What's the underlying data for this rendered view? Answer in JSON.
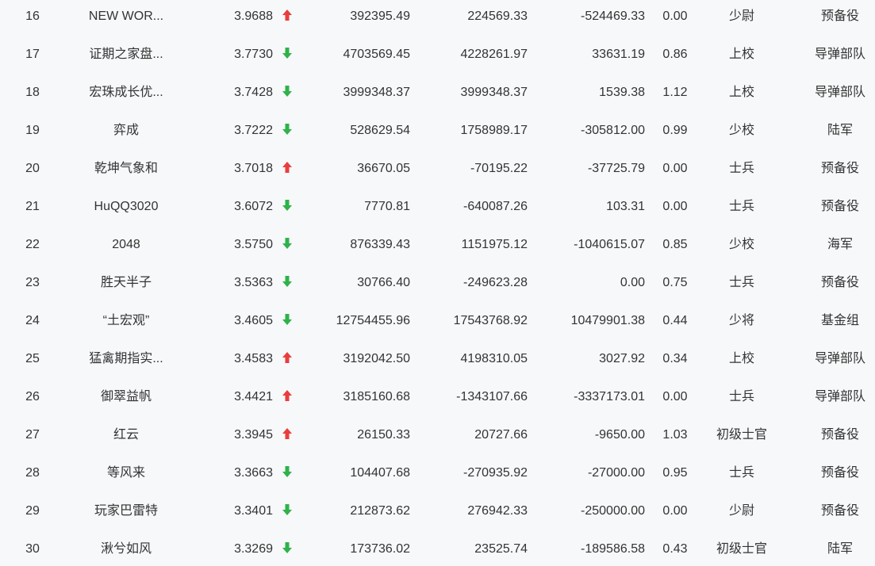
{
  "colors": {
    "up": "#e83e3e",
    "down": "#2fb24a"
  },
  "rows": [
    {
      "rank": "16",
      "name": "NEW WOR...",
      "score": "3.9688",
      "trend": "up",
      "v1": "392395.49",
      "v2": "224569.33",
      "v3": "-524469.33",
      "ratio": "0.00",
      "title": "少尉",
      "unit": "预备役"
    },
    {
      "rank": "17",
      "name": "证期之家盘...",
      "score": "3.7730",
      "trend": "down",
      "v1": "4703569.45",
      "v2": "4228261.97",
      "v3": "33631.19",
      "ratio": "0.86",
      "title": "上校",
      "unit": "导弹部队"
    },
    {
      "rank": "18",
      "name": "宏珠成长优...",
      "score": "3.7428",
      "trend": "down",
      "v1": "3999348.37",
      "v2": "3999348.37",
      "v3": "1539.38",
      "ratio": "1.12",
      "title": "上校",
      "unit": "导弹部队"
    },
    {
      "rank": "19",
      "name": "弈成",
      "score": "3.7222",
      "trend": "down",
      "v1": "528629.54",
      "v2": "1758989.17",
      "v3": "-305812.00",
      "ratio": "0.99",
      "title": "少校",
      "unit": "陆军"
    },
    {
      "rank": "20",
      "name": "乾坤气象和",
      "score": "3.7018",
      "trend": "up",
      "v1": "36670.05",
      "v2": "-70195.22",
      "v3": "-37725.79",
      "ratio": "0.00",
      "title": "士兵",
      "unit": "预备役"
    },
    {
      "rank": "21",
      "name": "HuQQ3020",
      "score": "3.6072",
      "trend": "down",
      "v1": "7770.81",
      "v2": "-640087.26",
      "v3": "103.31",
      "ratio": "0.00",
      "title": "士兵",
      "unit": "预备役"
    },
    {
      "rank": "22",
      "name": "2048",
      "score": "3.5750",
      "trend": "down",
      "v1": "876339.43",
      "v2": "1151975.12",
      "v3": "-1040615.07",
      "ratio": "0.85",
      "title": "少校",
      "unit": "海军"
    },
    {
      "rank": "23",
      "name": "胜天半子",
      "score": "3.5363",
      "trend": "down",
      "v1": "30766.40",
      "v2": "-249623.28",
      "v3": "0.00",
      "ratio": "0.75",
      "title": "士兵",
      "unit": "预备役"
    },
    {
      "rank": "24",
      "name": "“土宏观”",
      "score": "3.4605",
      "trend": "down",
      "v1": "12754455.96",
      "v2": "17543768.92",
      "v3": "10479901.38",
      "ratio": "0.44",
      "title": "少将",
      "unit": "基金组"
    },
    {
      "rank": "25",
      "name": "猛禽期指实...",
      "score": "3.4583",
      "trend": "up",
      "v1": "3192042.50",
      "v2": "4198310.05",
      "v3": "3027.92",
      "ratio": "0.34",
      "title": "上校",
      "unit": "导弹部队"
    },
    {
      "rank": "26",
      "name": "御翠益帆",
      "score": "3.4421",
      "trend": "up",
      "v1": "3185160.68",
      "v2": "-1343107.66",
      "v3": "-3337173.01",
      "ratio": "0.00",
      "title": "士兵",
      "unit": "导弹部队"
    },
    {
      "rank": "27",
      "name": "红云",
      "score": "3.3945",
      "trend": "up",
      "v1": "26150.33",
      "v2": "20727.66",
      "v3": "-9650.00",
      "ratio": "1.03",
      "title": "初级士官",
      "unit": "预备役"
    },
    {
      "rank": "28",
      "name": "等风来",
      "score": "3.3663",
      "trend": "down",
      "v1": "104407.68",
      "v2": "-270935.92",
      "v3": "-27000.00",
      "ratio": "0.95",
      "title": "士兵",
      "unit": "预备役"
    },
    {
      "rank": "29",
      "name": "玩家巴雷特",
      "score": "3.3401",
      "trend": "down",
      "v1": "212873.62",
      "v2": "276942.33",
      "v3": "-250000.00",
      "ratio": "0.00",
      "title": "少尉",
      "unit": "预备役"
    },
    {
      "rank": "30",
      "name": "湫兮如风",
      "score": "3.3269",
      "trend": "down",
      "v1": "173736.02",
      "v2": "23525.74",
      "v3": "-189586.58",
      "ratio": "0.43",
      "title": "初级士官",
      "unit": "陆军"
    }
  ]
}
